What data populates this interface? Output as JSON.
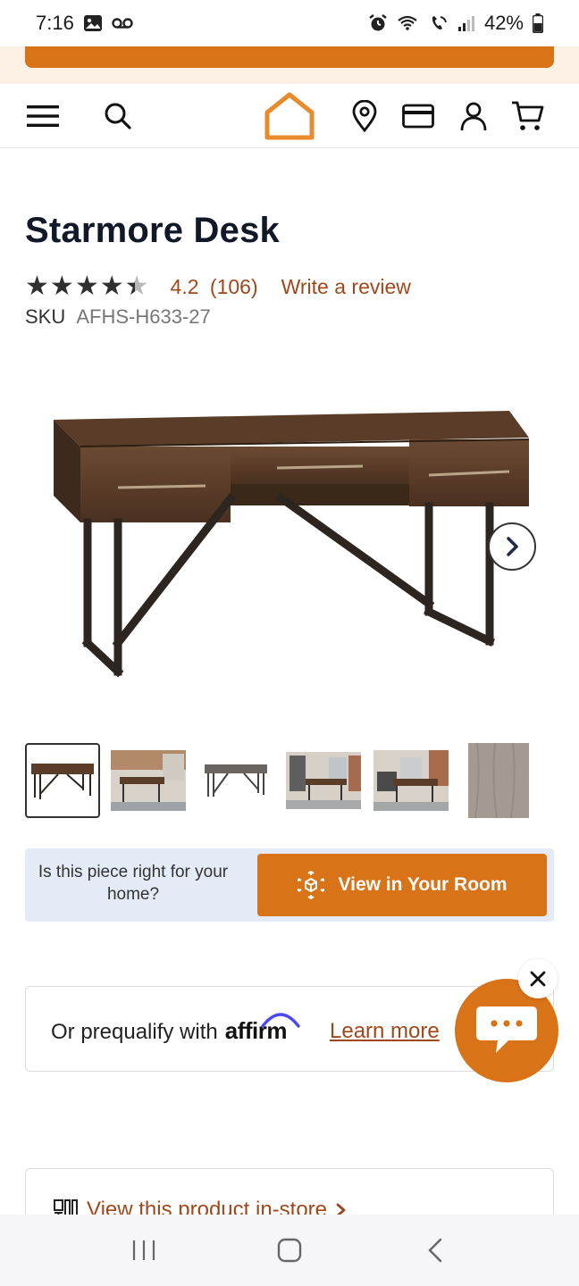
{
  "status_bar": {
    "time": "7:16",
    "battery": "42%"
  },
  "product": {
    "title": "Starmore Desk",
    "rating": "4.2",
    "review_count": "(106)",
    "write_review": "Write a review",
    "sku_label": "SKU",
    "sku_value": "AFHS-H633-27"
  },
  "ar_banner": {
    "question": "Is this piece right for your home?",
    "button_label": "View in Your Room"
  },
  "affirm": {
    "prefix": "Or prequalify with",
    "logo_text": "affirm",
    "learn_more": "Learn more"
  },
  "instore": {
    "link_text": "View this product in-store"
  },
  "colors": {
    "brand_orange": "#d97318",
    "link_rust": "#a0481c",
    "banner_blue": "#e5ebf6"
  },
  "icons": {
    "header": [
      "menu-icon",
      "search-icon",
      "home-logo-icon",
      "location-pin-icon",
      "credit-card-icon",
      "account-icon",
      "cart-icon"
    ],
    "nav": [
      "recent-apps-icon",
      "home-nav-icon",
      "back-icon"
    ]
  }
}
